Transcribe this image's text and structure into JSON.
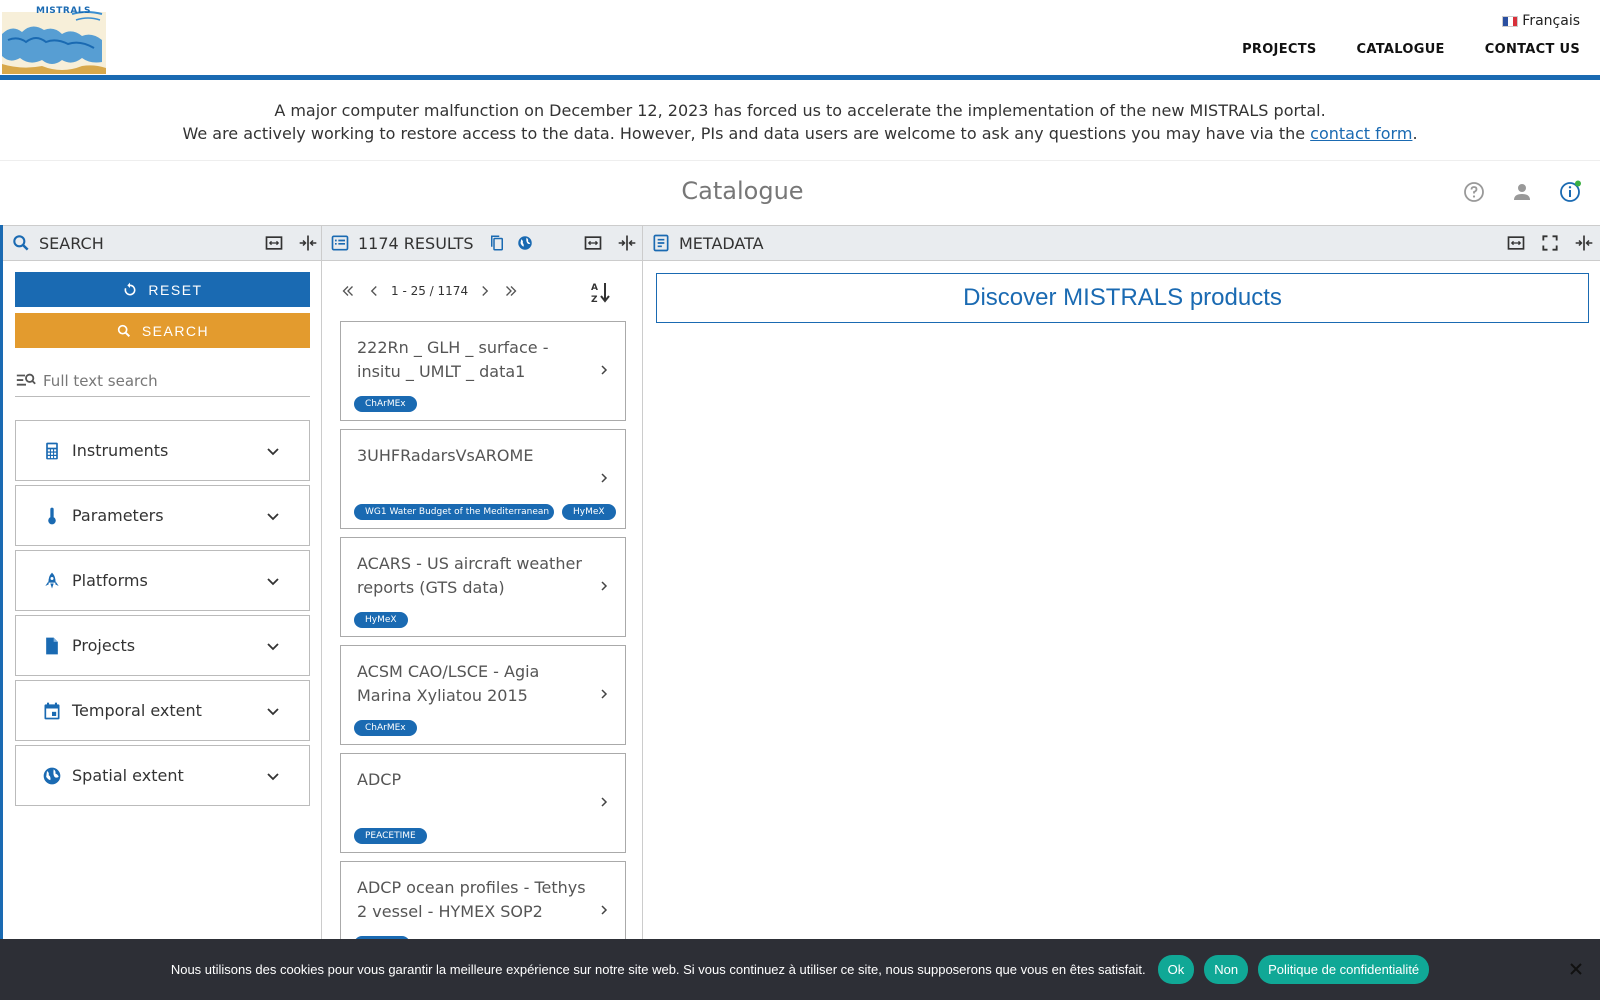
{
  "header": {
    "logo_text": "MISTRALS",
    "language": "Français",
    "nav": [
      "PROJECTS",
      "CATALOGUE",
      "CONTACT US"
    ]
  },
  "notice": {
    "line1": "A major computer malfunction on December 12, 2023 has forced us to accelerate the implementation of the new MISTRALS portal.",
    "line2_prefix": "We are actively working to restore access to the data. However, PIs and data users are welcome to ask any questions you may have via the ",
    "link": "contact form",
    "line2_suffix": "."
  },
  "catalogue": {
    "title": "Catalogue",
    "icons": [
      "help-icon",
      "account-icon",
      "info-icon"
    ]
  },
  "search_panel": {
    "title": "SEARCH",
    "reset_label": "RESET",
    "search_label": "SEARCH",
    "fulltext_placeholder": "Full text search",
    "facets": [
      {
        "label": "Instruments",
        "icon": "calculator-icon"
      },
      {
        "label": "Parameters",
        "icon": "thermometer-icon"
      },
      {
        "label": "Platforms",
        "icon": "rocket-icon"
      },
      {
        "label": "Projects",
        "icon": "file-icon"
      },
      {
        "label": "Temporal extent",
        "icon": "calendar-icon"
      },
      {
        "label": "Spatial extent",
        "icon": "globe-icon"
      }
    ]
  },
  "results_panel": {
    "title": "1174 RESULTS",
    "pager": "1 - 25 / 1174",
    "items": [
      {
        "title": "222Rn _ GLH _ surface - insitu _ UMLT _ data1",
        "tags": [
          "ChArMEx"
        ]
      },
      {
        "title": "3UHFRadarsVsAROME",
        "tags": [
          "WG1 Water Budget of the Mediterranean",
          "HyMeX"
        ]
      },
      {
        "title": "ACARS - US aircraft weather reports (GTS data)",
        "tags": [
          "HyMeX"
        ]
      },
      {
        "title": "ACSM CAO/LSCE - Agia Marina Xyliatou 2015",
        "tags": [
          "ChArMEx"
        ]
      },
      {
        "title": "ADCP",
        "tags": [
          "PEACETIME"
        ]
      },
      {
        "title": "ADCP ocean profiles - Tethys 2 vessel - HYMEX SOP2",
        "tags": [
          ""
        ]
      }
    ]
  },
  "metadata_panel": {
    "title": "METADATA",
    "discover": "Discover MISTRALS products"
  },
  "cookie": {
    "text": "Nous utilisons des cookies pour vous garantir la meilleure expérience sur notre site web. Si vous continuez à utiliser ce site, nous supposerons que vous en êtes satisfait.",
    "ok": "Ok",
    "no": "Non",
    "policy": "Politique de confidentialité"
  },
  "colors": {
    "primary": "#1a6ab2",
    "search_button": "#e39b2e",
    "cookie_bg": "#2d2f36",
    "cookie_button": "#10a896"
  }
}
